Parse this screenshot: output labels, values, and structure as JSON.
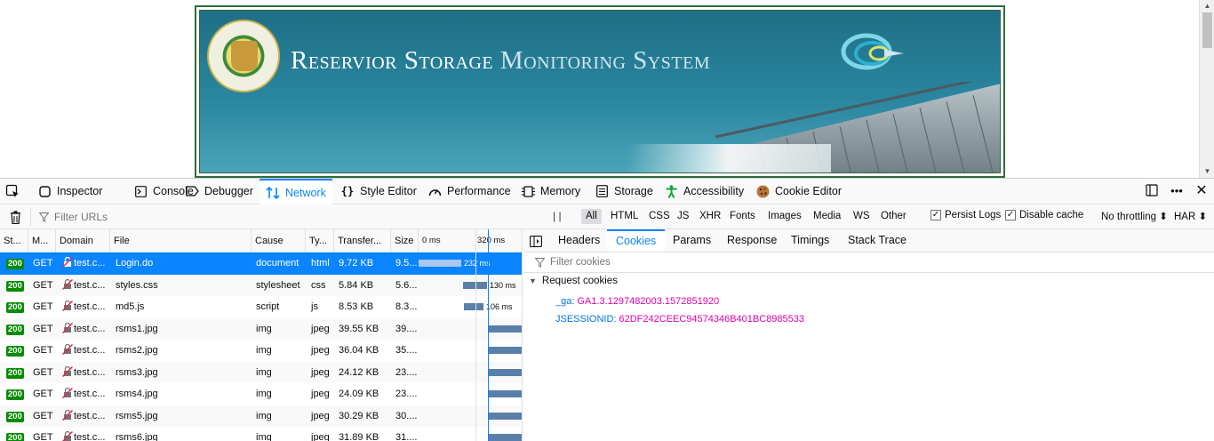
{
  "page": {
    "title_part1": "Reservior Storage",
    "title_part2": "Monitoring System",
    "emblem_label": "Government of Andhra Pradesh emblem"
  },
  "devtools": {
    "tabs": [
      {
        "label": "Inspector",
        "icon": "inspector-icon"
      },
      {
        "label": "Console",
        "icon": "console-icon"
      },
      {
        "label": "Debugger",
        "icon": "debugger-icon"
      },
      {
        "label": "Network",
        "icon": "network-icon",
        "active": true
      },
      {
        "label": "Style Editor",
        "icon": "style-editor-icon"
      },
      {
        "label": "Performance",
        "icon": "performance-icon"
      },
      {
        "label": "Memory",
        "icon": "memory-icon"
      },
      {
        "label": "Storage",
        "icon": "storage-icon"
      },
      {
        "label": "Accessibility",
        "icon": "accessibility-icon"
      },
      {
        "label": "Cookie Editor",
        "icon": "cookie-icon"
      }
    ],
    "toolbar": {
      "filter_placeholder": "Filter URLs",
      "pause_label": "| |",
      "types": [
        "All",
        "HTML",
        "CSS",
        "JS",
        "XHR",
        "Fonts",
        "Images",
        "Media",
        "WS",
        "Other"
      ],
      "active_type": "All",
      "persist_logs": "Persist Logs",
      "persist_logs_checked": true,
      "disable_cache": "Disable cache",
      "disable_cache_checked": true,
      "throttling": "No throttling ⬍",
      "har": "HAR ⬍"
    },
    "table": {
      "headers": [
        "St...",
        "M...",
        "Domain",
        "File",
        "Cause",
        "Ty...",
        "Transfer...",
        "Size",
        "0 ms",
        "320 ms"
      ],
      "rows": [
        {
          "status": "200",
          "method": "GET",
          "domain": "test.c...",
          "file": "Login.do",
          "cause": "document",
          "type": "html",
          "transferred": "9.72 KB",
          "size": "9.5...",
          "time_ms": 232,
          "time_label": "232 ms"
        },
        {
          "status": "200",
          "method": "GET",
          "domain": "test.c...",
          "file": "styles.css",
          "cause": "stylesheet",
          "type": "css",
          "transferred": "5.84 KB",
          "size": "5.6...",
          "time_ms": 130,
          "time_label": "130 ms"
        },
        {
          "status": "200",
          "method": "GET",
          "domain": "test.c...",
          "file": "md5.js",
          "cause": "script",
          "type": "js",
          "transferred": "8.53 KB",
          "size": "8.3...",
          "time_ms": 106,
          "time_label": "106 ms"
        },
        {
          "status": "200",
          "method": "GET",
          "domain": "test.c...",
          "file": "rsms1.jpg",
          "cause": "img",
          "type": "jpeg",
          "transferred": "39.55 KB",
          "size": "39...."
        },
        {
          "status": "200",
          "method": "GET",
          "domain": "test.c...",
          "file": "rsms2.jpg",
          "cause": "img",
          "type": "jpeg",
          "transferred": "36.04 KB",
          "size": "35...."
        },
        {
          "status": "200",
          "method": "GET",
          "domain": "test.c...",
          "file": "rsms3.jpg",
          "cause": "img",
          "type": "jpeg",
          "transferred": "24.12 KB",
          "size": "23...."
        },
        {
          "status": "200",
          "method": "GET",
          "domain": "test.c...",
          "file": "rsms4.jpg",
          "cause": "img",
          "type": "jpeg",
          "transferred": "24.09 KB",
          "size": "23...."
        },
        {
          "status": "200",
          "method": "GET",
          "domain": "test.c...",
          "file": "rsms5.jpg",
          "cause": "img",
          "type": "jpeg",
          "transferred": "30.29 KB",
          "size": "30...."
        },
        {
          "status": "200",
          "method": "GET",
          "domain": "test.c...",
          "file": "rsms6.jpg",
          "cause": "img",
          "type": "jpeg",
          "transferred": "31.89 KB",
          "size": "31...."
        }
      ],
      "selected_index": 0
    },
    "details": {
      "tabs": [
        "Headers",
        "Cookies",
        "Params",
        "Response",
        "Timings",
        "Stack Trace"
      ],
      "active_tab": "Cookies",
      "filter_placeholder": "Filter cookies",
      "section_title": "Request cookies",
      "cookies": [
        {
          "name": "_ga:",
          "value": "GA1.3.1297482003.1572851920"
        },
        {
          "name": "JSESSIONID:",
          "value": "62DF242CEEC94574346B401BC8985533"
        }
      ]
    }
  },
  "colors": {
    "accent": "#0a84ff",
    "status_ok": "#058b00",
    "cookie_name": "#0074e8",
    "cookie_value": "#dd00a9"
  }
}
